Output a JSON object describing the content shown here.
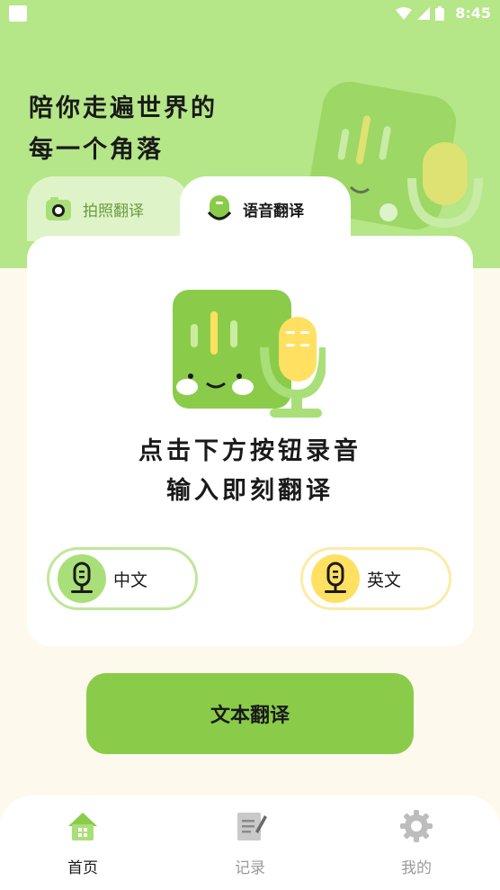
{
  "status_bar": {
    "time": "8:45"
  },
  "slogan": {
    "line1": "陪你走遍世界的",
    "line2": "每一个角落"
  },
  "tabs": [
    {
      "label": "拍照翻译",
      "icon": "camera-icon",
      "active": false
    },
    {
      "label": "语音翻译",
      "icon": "voice-face-icon",
      "active": true
    }
  ],
  "card": {
    "prompt_line1": "点击下方按钮录音",
    "prompt_line2": "输入即刻翻译"
  },
  "languages": [
    {
      "label": "中文",
      "icon": "microphone-icon",
      "color": "#a9df78"
    },
    {
      "label": "英文",
      "icon": "microphone-icon",
      "color": "#ffe061"
    }
  ],
  "text_translate_button": {
    "label": "文本翻译"
  },
  "bottom_nav": [
    {
      "label": "首页",
      "icon": "home-icon",
      "active": true
    },
    {
      "label": "记录",
      "icon": "notepad-icon",
      "active": false
    },
    {
      "label": "我的",
      "icon": "gear-icon",
      "active": false
    }
  ],
  "colors": {
    "accent_green": "#8acc4a",
    "header_green": "#b5e688",
    "accent_yellow": "#ffe061",
    "background": "#fdf9ec"
  }
}
